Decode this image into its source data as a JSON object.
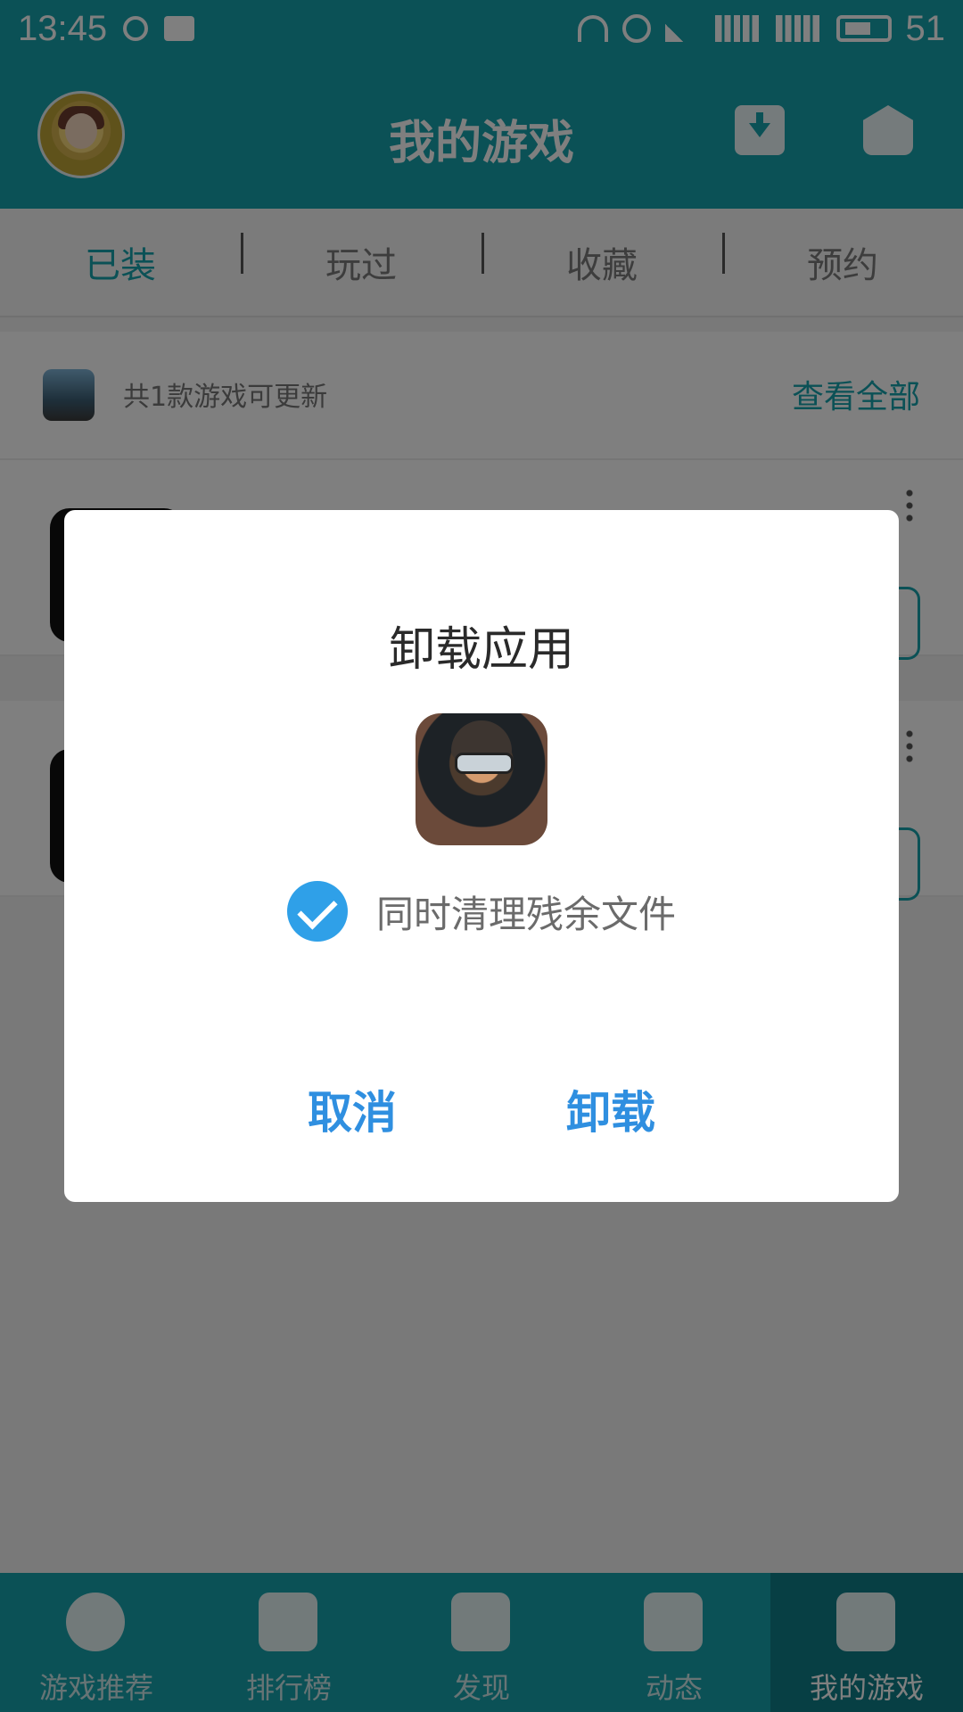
{
  "status_bar": {
    "time": "13:45",
    "battery": "51"
  },
  "app_bar": {
    "title": "我的游戏",
    "icons": [
      "avatar",
      "download-box-icon",
      "rocket-icon"
    ]
  },
  "tabs": [
    {
      "label": "已装",
      "active": true
    },
    {
      "label": "玩过",
      "active": false
    },
    {
      "label": "收藏",
      "active": false
    },
    {
      "label": "预约",
      "active": false
    }
  ],
  "update_banner": {
    "text": "共1款游戏可更新",
    "view_all": "查看全部"
  },
  "dialog": {
    "title": "卸载应用",
    "checkbox_label": "同时清理残余文件",
    "checkbox_checked": true,
    "cancel_label": "取消",
    "confirm_label": "卸载"
  },
  "bottom_nav": [
    {
      "label": "游戏推荐",
      "icon": "star-icon",
      "active": false
    },
    {
      "label": "排行榜",
      "icon": "trophy-icon",
      "active": false
    },
    {
      "label": "发现",
      "icon": "sparkle-icon",
      "active": false
    },
    {
      "label": "动态",
      "icon": "heart-icon",
      "active": false
    },
    {
      "label": "我的游戏",
      "icon": "paper-plane-icon",
      "active": true
    }
  ],
  "colors": {
    "primary": "#17a3ad",
    "accent_blue": "#2f8fe0"
  }
}
